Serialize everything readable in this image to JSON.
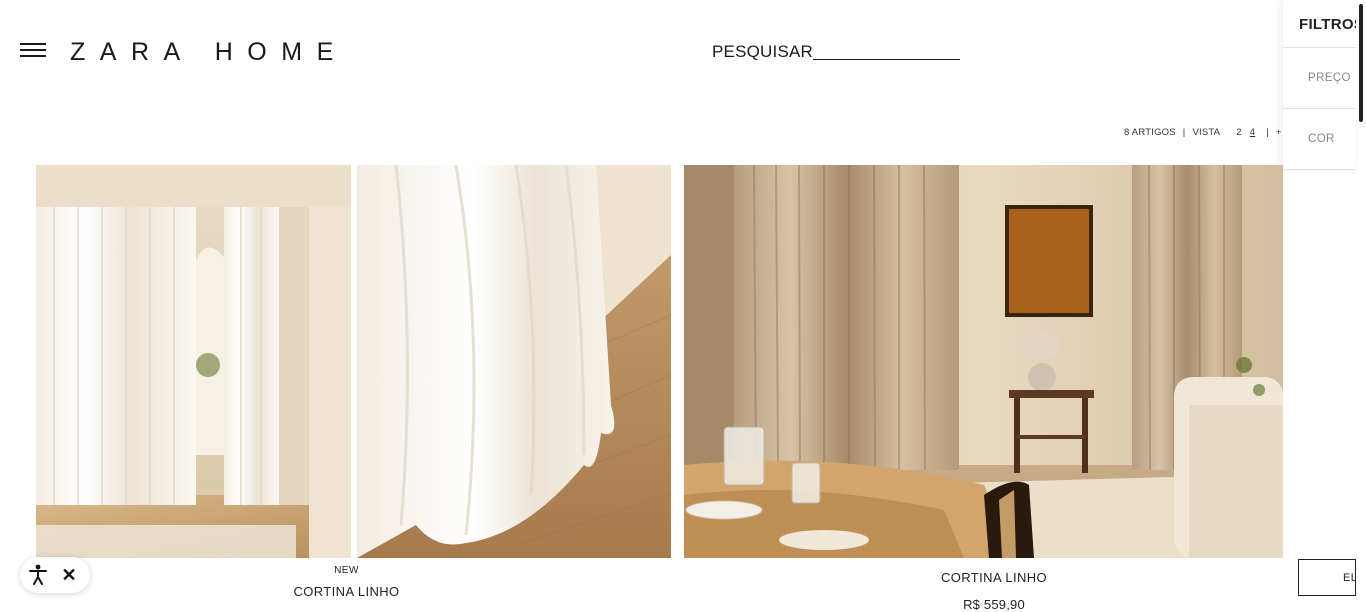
{
  "header": {
    "logo": "ZARA HOME",
    "search_label": "PESQUISAR"
  },
  "view_controls": {
    "count": "8 ARTIGOS",
    "view_label": "VISTA",
    "options": [
      "2",
      "4"
    ],
    "selected": "4",
    "plus": "+"
  },
  "filters": {
    "title": "FILTROS",
    "items": [
      "PREÇO",
      "COR"
    ]
  },
  "products": [
    {
      "badge": "NEW",
      "name": "CORTINA LINHO",
      "price": ""
    },
    {
      "badge": "",
      "name": "CORTINA LINHO",
      "price": "R$ 559,90"
    }
  ],
  "bottom_button": {
    "label": "ELIMINAR"
  },
  "icons": {
    "menu": "hamburger-icon",
    "accessibility": "accessibility-icon",
    "close": "close-icon"
  },
  "colors": {
    "text": "#1a1a1a",
    "muted": "#888888",
    "background": "#ffffff"
  }
}
